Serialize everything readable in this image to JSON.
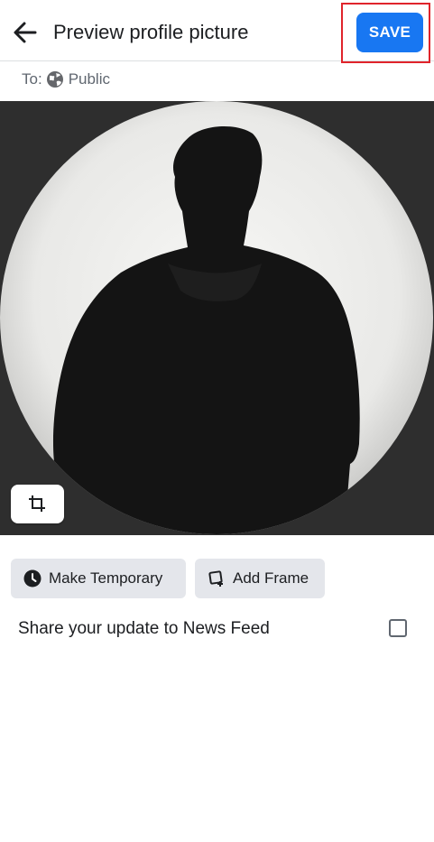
{
  "header": {
    "title": "Preview profile picture",
    "save_label": "SAVE",
    "back_icon": "arrow-left-icon"
  },
  "audience": {
    "to_label": "To:",
    "value": "Public",
    "icon": "globe-icon"
  },
  "photo": {
    "edit_icon": "crop-icon"
  },
  "actions": {
    "make_temporary": "Make Temporary",
    "add_frame": "Add Frame"
  },
  "share": {
    "label": "Share your update to News Feed",
    "checked": false
  },
  "colors": {
    "accent": "#1877f2",
    "highlight": "#e0242b",
    "chip_bg": "#e4e6eb"
  }
}
